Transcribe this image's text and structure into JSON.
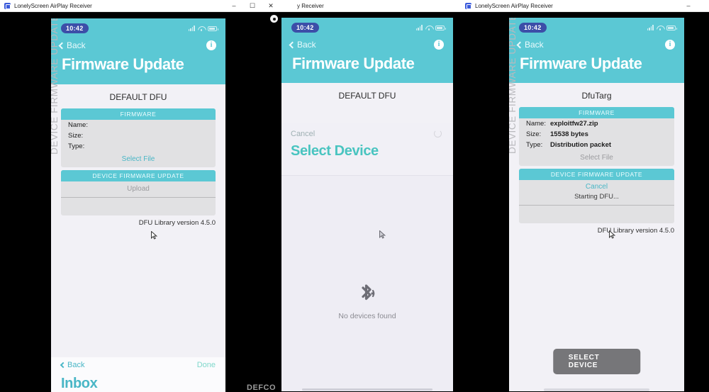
{
  "windows": [
    {
      "title": "LonelyScreen AirPlay Receiver",
      "minimize": "–",
      "maximize": "☐",
      "close": "✕"
    },
    {
      "title": "y Receiver"
    },
    {
      "title": "LonelyScreen AirPlay Receiver",
      "minimize": "–"
    }
  ],
  "panel1": {
    "status": {
      "time": "10:42"
    },
    "nav": {
      "back": "Back",
      "info": "i"
    },
    "title": "Firmware Update",
    "device_name": "DEFAULT DFU",
    "firmware_card": {
      "header": "FIRMWARE",
      "rows": [
        {
          "label": "Name:",
          "value": ""
        },
        {
          "label": "Size:",
          "value": ""
        },
        {
          "label": "Type:",
          "value": ""
        }
      ],
      "select_file": "Select File"
    },
    "dfu_card": {
      "header": "DEVICE FIRMWARE UPDATE",
      "action": "Upload"
    },
    "vertical_label": "DEVICE FIRMWARE UPDATE",
    "dfu_version": "DFU Library version 4.5.0",
    "bottom": {
      "back": "Back",
      "done": "Done",
      "title": "Inbox"
    }
  },
  "panel2": {
    "status": {
      "time": "10:42"
    },
    "nav": {
      "back": "Back",
      "info": "i"
    },
    "title": "Firmware Update",
    "device_name": "DEFAULT DFU",
    "sheet": {
      "cancel": "Cancel",
      "title": "Select Device",
      "empty_text": "No devices found",
      "empty_icon": "bluetooth-icon"
    }
  },
  "panel3": {
    "status": {
      "time": "10:42"
    },
    "nav": {
      "back": "Back",
      "info": "i"
    },
    "title": "Firmware Update",
    "device_name": "DfuTarg",
    "firmware_card": {
      "header": "FIRMWARE",
      "rows": [
        {
          "label": "Name:",
          "value": "exploitfw27.zip"
        },
        {
          "label": "Size:",
          "value": "15538 bytes"
        },
        {
          "label": "Type:",
          "value": "Distribution packet"
        }
      ],
      "select_file": "Select File"
    },
    "dfu_card": {
      "header": "DEVICE FIRMWARE UPDATE",
      "action": "Cancel",
      "status": "Starting DFU..."
    },
    "vertical_label": "DEVICE FIRMWARE UPDATE",
    "dfu_version": "DFU Library version 4.5.0",
    "select_device_button": "SELECT DEVICE"
  },
  "background": {
    "partial_text": "DEFCO"
  },
  "colors": {
    "teal": "#5bc8d4",
    "teal_link": "#49b6c6",
    "card_gray": "#e1e1e3",
    "page_bg": "#f2f1f6",
    "button_gray": "#767679"
  }
}
